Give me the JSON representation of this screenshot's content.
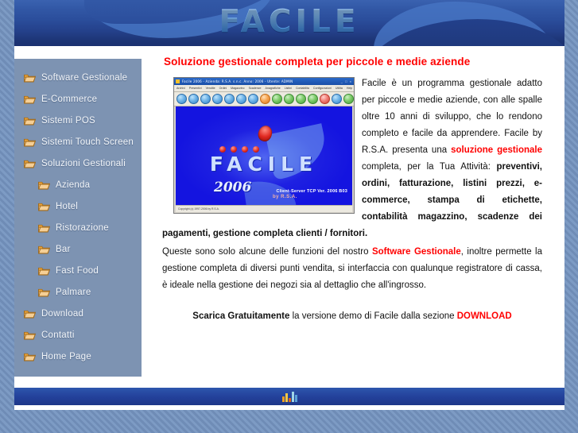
{
  "header": {
    "logo_text": "FACILE"
  },
  "sidebar": {
    "items": [
      {
        "label": "Software Gestionale",
        "sub": false,
        "icon": "folder-icon"
      },
      {
        "label": "E-Commerce",
        "sub": false,
        "icon": "folder-icon"
      },
      {
        "label": "Sistemi POS",
        "sub": false,
        "icon": "folder-icon"
      },
      {
        "label": "Sistemi Touch Screen",
        "sub": false,
        "icon": "folder-icon"
      },
      {
        "label": "Soluzioni Gestionali",
        "sub": false,
        "icon": "folder-icon"
      },
      {
        "label": "Azienda",
        "sub": true,
        "icon": "folder-icon"
      },
      {
        "label": "Hotel",
        "sub": true,
        "icon": "folder-icon"
      },
      {
        "label": "Ristorazione",
        "sub": true,
        "icon": "folder-icon"
      },
      {
        "label": "Bar",
        "sub": true,
        "icon": "folder-icon"
      },
      {
        "label": "Fast Food",
        "sub": true,
        "icon": "folder-icon"
      },
      {
        "label": "Palmare",
        "sub": true,
        "icon": "folder-icon"
      },
      {
        "label": "Download",
        "sub": false,
        "icon": "folder-icon"
      },
      {
        "label": "Contatti",
        "sub": false,
        "icon": "folder-icon"
      },
      {
        "label": "Home Page",
        "sub": false,
        "icon": "folder-icon"
      }
    ]
  },
  "main": {
    "heading": "Soluzione gestionale completa per piccole e medie aziende",
    "paragraph1_part1": "Facile è un programma gestionale adatto per piccole e medie aziende, con alle spalle oltre 10 anni di sviluppo, che lo rendono completo e facile da apprendere. Facile by R.S.A. presenta una ",
    "paragraph1_link": "soluzione gestionale",
    "paragraph1_part2": " completa, per la Tua Attività: ",
    "paragraph1_bold": "preventivi, ordini, fatturazione, listini prezzi, e-commerce, stampa di etichette, contabilità magazzino, scadenze dei pagamenti, gestione completa clienti / fornitori.",
    "paragraph2_part1": "Queste sono solo alcune delle funzioni del nostro ",
    "paragraph2_link": "Software Gestionale",
    "paragraph2_part2": ", inoltre permette la gestione completa di diversi punti vendita, si interfaccia con qualunque registratore di cassa, è ideale nella gestione dei negozi sia al dettaglio che all'ingrosso.",
    "cta_bold": "Scarica Gratuitamente",
    "cta_text": " la versione demo di Facile dalla sezione ",
    "cta_link": "DOWNLOAD"
  },
  "app_screenshot": {
    "title": "Facile 2006 - Azienda: R.S.A. s.n.c. Anno: 2006 - Utente: ADMIN",
    "window_buttons": "_ □ ×",
    "menu_items": [
      "Archivi",
      "Presentivi",
      "Vendite",
      "Ordini",
      "Magazzino",
      "Scadenze",
      "Anagrafiche",
      "Listini",
      "Contabilita",
      "Configurazioni",
      "Utilita",
      "Help"
    ],
    "splash_title": "FACILE",
    "splash_year": "2006",
    "splash_by": "by R.S.A.",
    "splash_version": "Client-Server TCP Ver. 2006 B03",
    "status_text": "Copyright (c) 1997-2006 by R.S.A."
  },
  "footer": {
    "counter_icon": "bar-chart-counter-icon"
  },
  "colors": {
    "accent_red": "#ff0000",
    "header_blue": "#2b4e9c",
    "sidebar_blue": "#7d93b2",
    "footer_blue": "#23409a",
    "folder_orange": "#e8a33d"
  }
}
